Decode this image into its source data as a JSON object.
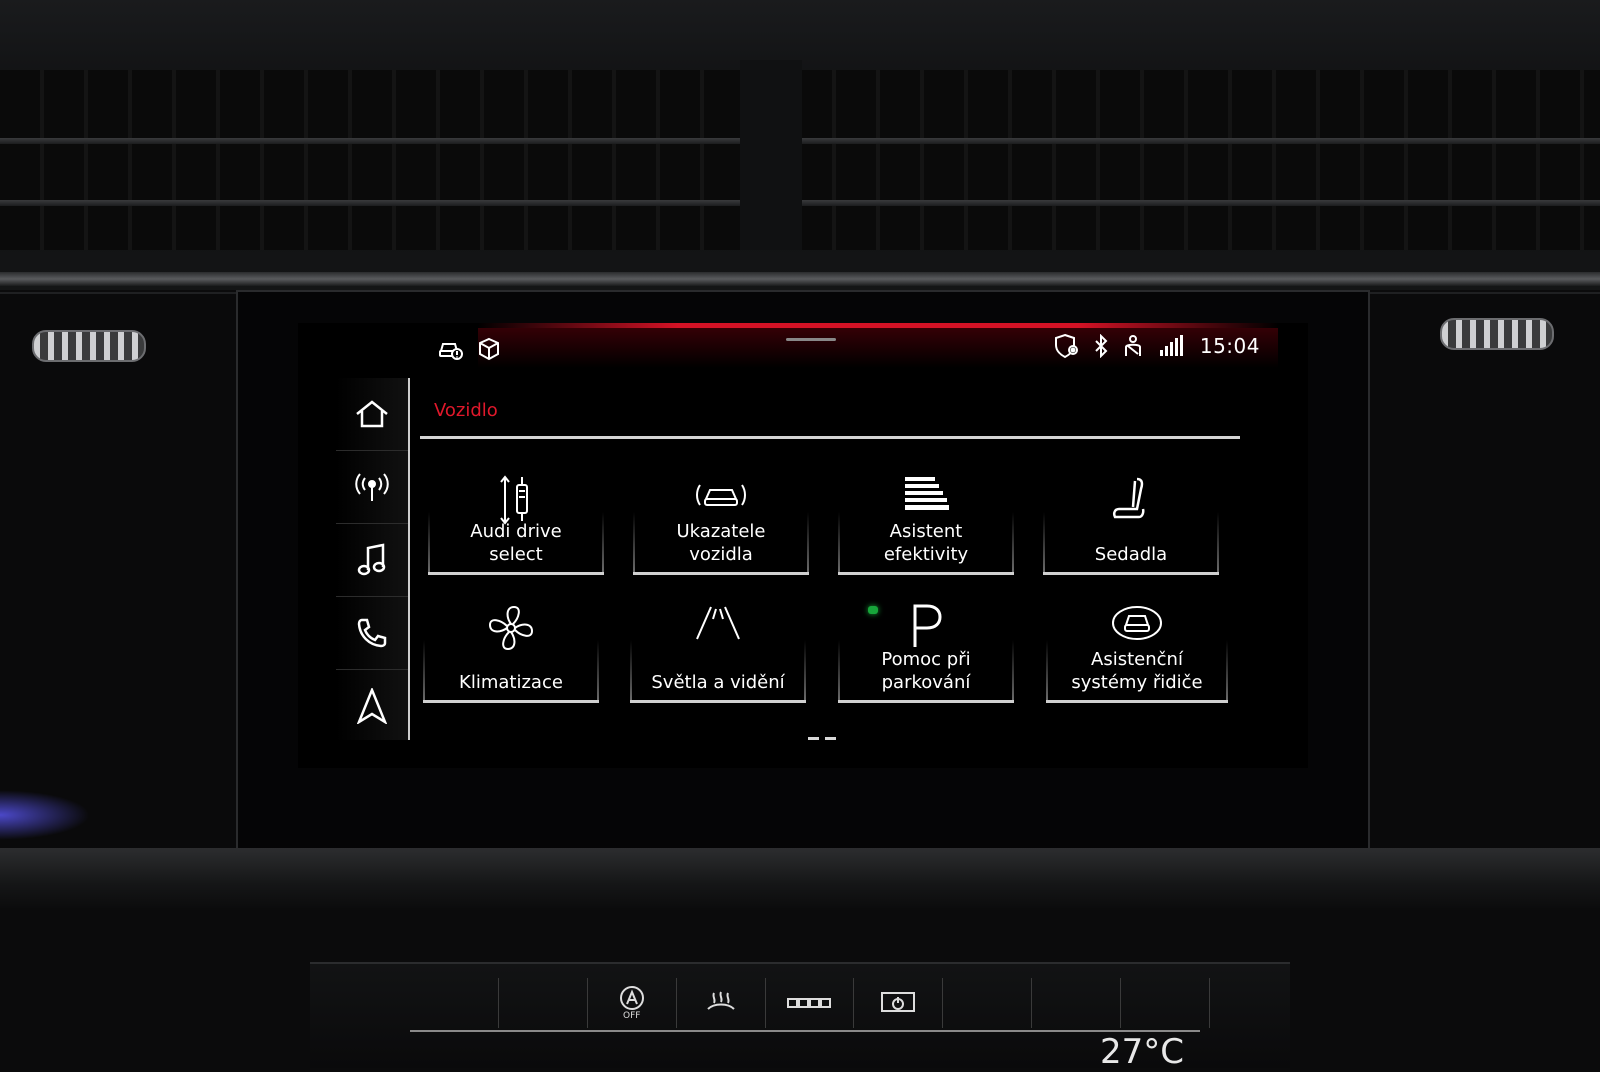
{
  "status_bar": {
    "time": "15:04",
    "left_icons": [
      "car-service-icon",
      "package-box-icon"
    ],
    "right_icons": [
      "shield-location-icon",
      "bluetooth-icon",
      "seatbelt-person-icon",
      "lte-signal-icon"
    ]
  },
  "sidebar": {
    "items": [
      {
        "name": "home",
        "icon": "home-icon"
      },
      {
        "name": "radio",
        "icon": "radio-antenna-icon"
      },
      {
        "name": "media",
        "icon": "music-note-icon"
      },
      {
        "name": "phone",
        "icon": "phone-icon"
      },
      {
        "name": "navigation",
        "icon": "navigation-arrow-icon"
      }
    ]
  },
  "page": {
    "title": "Vozidlo"
  },
  "tiles": [
    {
      "label": "Audi drive\nselect",
      "icon": "suspension-icon"
    },
    {
      "label": "Ukazatele\nvozidla",
      "icon": "car-status-icon"
    },
    {
      "label": "Asistent\nefektivity",
      "icon": "efficiency-icon"
    },
    {
      "label": "Sedadla",
      "icon": "seat-icon"
    },
    {
      "label": "Klimatizace",
      "icon": "fan-icon"
    },
    {
      "label": "Světla a vidění",
      "icon": "road-lights-icon"
    },
    {
      "label": "Pomoc při\nparkování",
      "icon": "parking-icon"
    },
    {
      "label": "Asistenční\nsystémy řidiče",
      "icon": "driver-assist-icon"
    }
  ],
  "pager": {
    "pages": 2
  },
  "climate": {
    "auto_off_label": "OFF",
    "temperature": "27°C",
    "cells": [
      "auto-off-icon",
      "heated-windshield-icon",
      "rear-defrost-icon",
      "power-icon"
    ]
  },
  "colors": {
    "accent_red": "#e0182b",
    "background": "#000000",
    "parking_indicator": "#17a53a"
  }
}
